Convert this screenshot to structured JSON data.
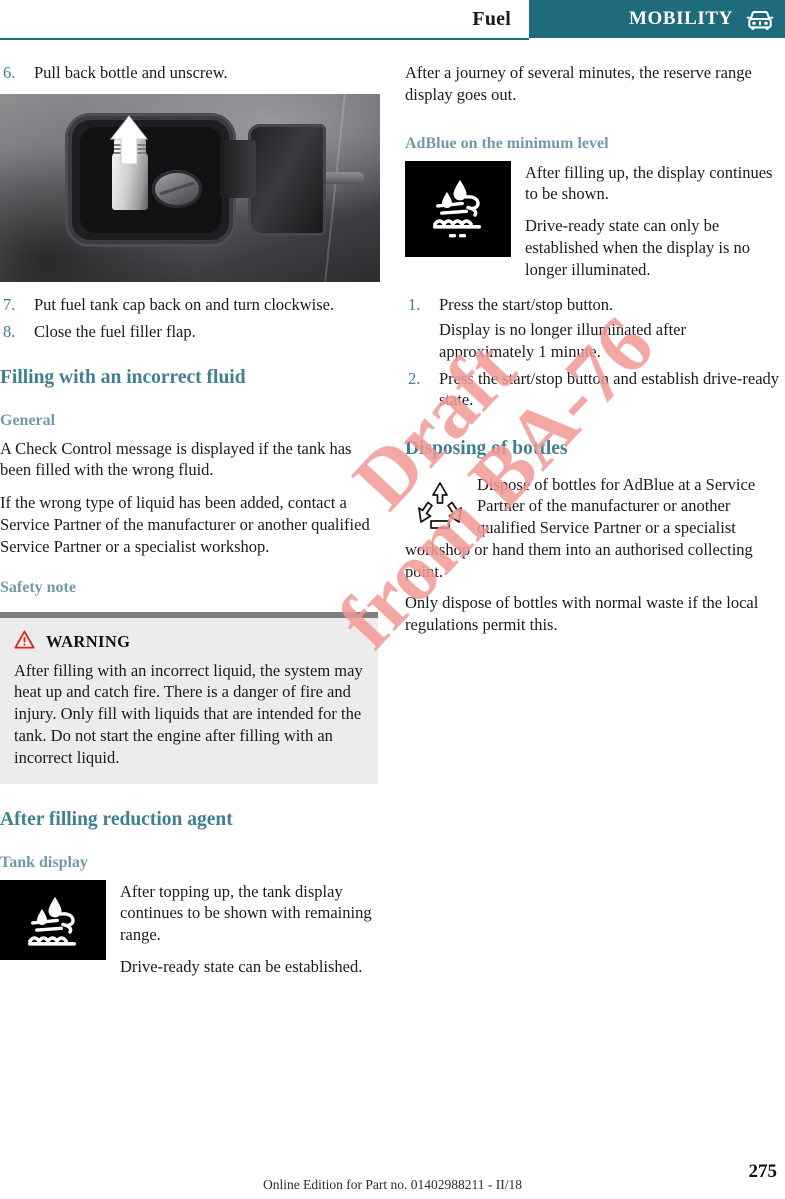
{
  "header": {
    "chapter": "Fuel",
    "section": "MOBILITY",
    "icon": "car-front-icon",
    "accent_color": "#1e6c7b",
    "band_color": "#1e6c7b"
  },
  "watermark": {
    "line1": "Draft",
    "line2": "from BA-76",
    "color": "#f19a95"
  },
  "left_column": {
    "steps_top": [
      {
        "num": "6.",
        "text": "Pull back bottle and unscrew."
      }
    ],
    "photo": {
      "alt": "Fuel filler flap with AdBlue bottle being pulled up and unscrewed",
      "icon": "fuel-filler-photo"
    },
    "steps_after_photo": [
      {
        "num": "7.",
        "text": "Put fuel tank cap back on and turn clockwise."
      },
      {
        "num": "8.",
        "text": "Close the fuel filler flap."
      }
    ],
    "heading_filling": "Filling with an incorrect fluid",
    "heading_general": "General",
    "general_paragraphs": [
      "A Check Control message is displayed if the tank has been filled with the wrong fluid.",
      "If the wrong type of liquid has been added, contact a Service Partner of the manufacturer or another qualified Service Partner or a specialist workshop."
    ],
    "heading_safety": "Safety note",
    "warning": {
      "icon": "warning-triangle-icon",
      "title": "WARNING",
      "body": "After filling with an incorrect liquid, the system may heat up and catch fire. There is a danger of fire and injury. Only fill with liquids that are intended for the tank. Do not start the engine after filling with an incorrect liquid."
    },
    "heading_after_filling": "After filling reduction agent",
    "heading_tank_display": "Tank display",
    "tank_display": {
      "icon": "adblue-tank-indicator-icon",
      "paragraphs": [
        "After topping up, the tank display continues to be shown with remaining range.",
        "Drive-ready state can be established."
      ]
    }
  },
  "right_column": {
    "intro_paragraph": "After a journey of several minutes, the reserve range display goes out.",
    "heading_adblue_min": "AdBlue on the minimum level",
    "adblue_display": {
      "icon": "adblue-minimum-level-icon",
      "paragraphs": [
        "After filling up, the display continues to be shown.",
        "Drive-ready state can only be established when the display is no longer illuminated."
      ]
    },
    "steps": [
      {
        "num": "1.",
        "text": "Press the start/stop button.",
        "sub": "Display is no longer illuminated after approximately 1 minute."
      },
      {
        "num": "2.",
        "text": "Press the start/stop button and establish drive-ready state.",
        "sub": ""
      }
    ],
    "heading_disposing": "Disposing of bottles",
    "disposing": {
      "icon": "recycle-icon",
      "paragraphs": [
        "Dispose of bottles for AdBlue at a Service Partner of the manufacturer or another qualified Service Partner or a specialist workshop or hand them into an authorised collecting point.",
        "Only dispose of bottles with normal waste if the local regulations permit this."
      ]
    }
  },
  "footer": {
    "note": "Online Edition for Part no. 01402988211 - II/18",
    "page_number": "275"
  }
}
